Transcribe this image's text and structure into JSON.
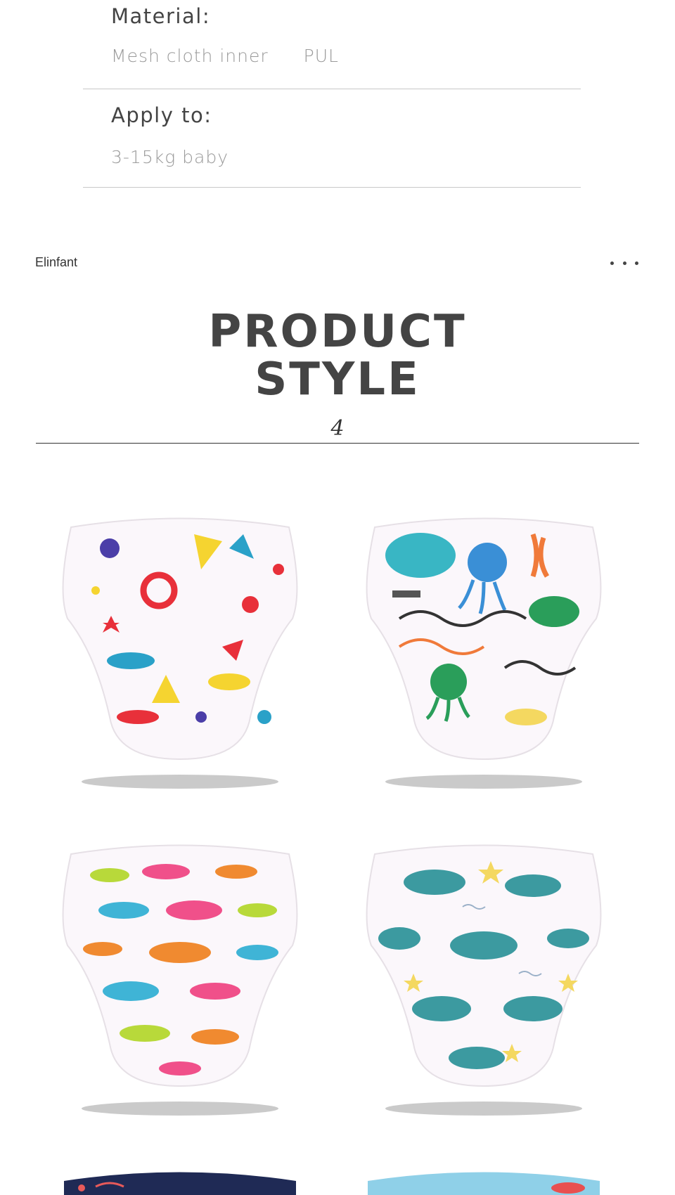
{
  "specs": {
    "material": {
      "title": "Material:",
      "values": [
        "Mesh cloth inner",
        "PUL"
      ]
    },
    "apply_to": {
      "title": "Apply to:",
      "value": "3-15kg baby"
    }
  },
  "brand": {
    "name": "Elinfant",
    "menu_icon": "more-horizontal-icon"
  },
  "section": {
    "title_line1": "PRODUCT",
    "title_line2": "STYLE",
    "number": "4"
  },
  "products": [
    {
      "pattern": "ocean-fish-starfish",
      "colors": [
        "#e8303a",
        "#f5d430",
        "#4b3ea8",
        "#2aa1c8"
      ]
    },
    {
      "pattern": "whale-octopus-coral",
      "colors": [
        "#39b6c4",
        "#3a8fd6",
        "#f07a3a",
        "#2a9e5a"
      ]
    },
    {
      "pattern": "rainbow-fish",
      "colors": [
        "#f0508a",
        "#3fb4d6",
        "#f08a30",
        "#b8d93a"
      ]
    },
    {
      "pattern": "teal-whales-stars",
      "colors": [
        "#3c9aa0",
        "#f4d860",
        "#9ab0c8"
      ]
    },
    {
      "pattern": "navy-pattern",
      "colors": [
        "#1f2a55",
        "#e85a5a"
      ]
    },
    {
      "pattern": "light-blue-pattern",
      "colors": [
        "#8fd0e8",
        "#e85050"
      ]
    }
  ]
}
